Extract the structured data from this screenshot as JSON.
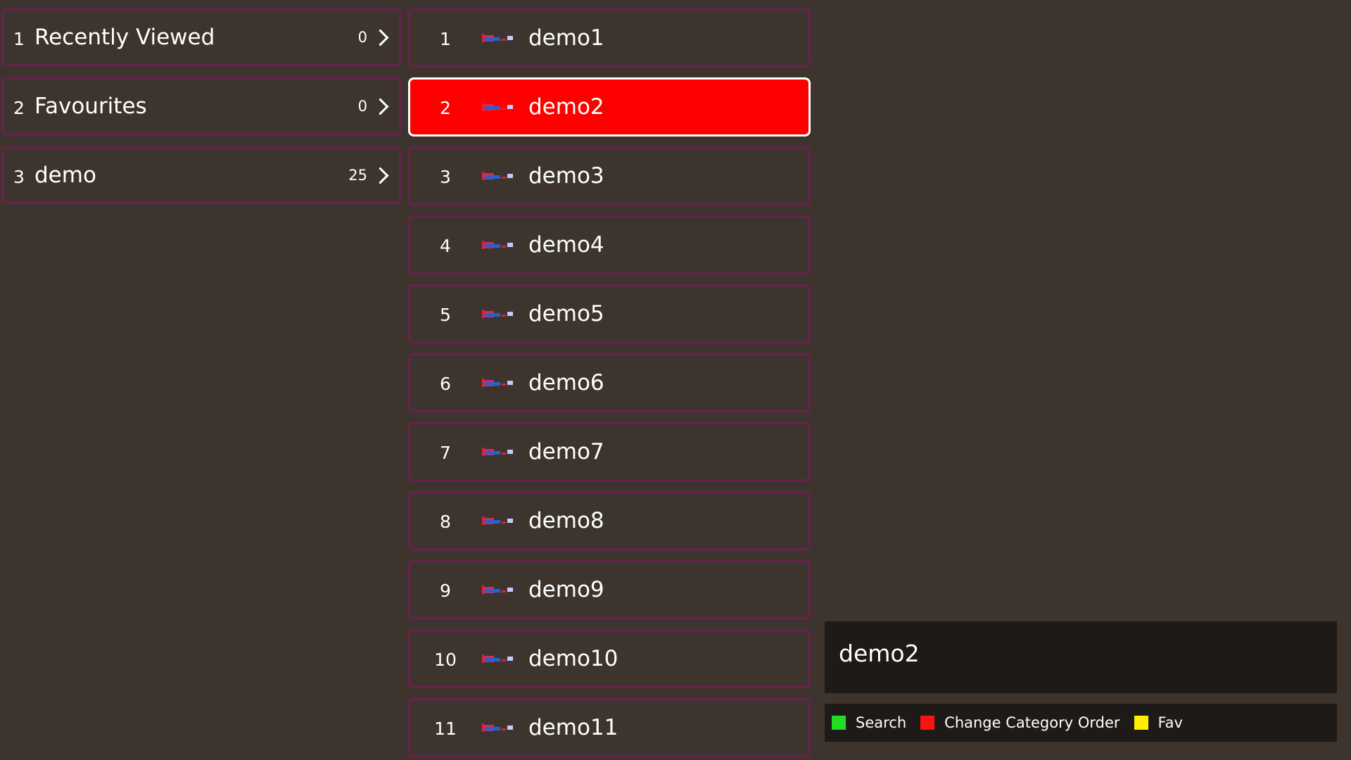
{
  "categories": [
    {
      "number": "1",
      "label": "Recently Viewed",
      "count": "0"
    },
    {
      "number": "2",
      "label": "Favourites",
      "count": "0"
    },
    {
      "number": "3",
      "label": "demo",
      "count": "25"
    }
  ],
  "channels": [
    {
      "number": "1",
      "label": "demo1",
      "logo": "channel-logo"
    },
    {
      "number": "2",
      "label": "demo2",
      "logo": "channel-logo",
      "selected": true
    },
    {
      "number": "3",
      "label": "demo3",
      "logo": "channel-logo"
    },
    {
      "number": "4",
      "label": "demo4",
      "logo": "channel-logo"
    },
    {
      "number": "5",
      "label": "demo5",
      "logo": "channel-logo"
    },
    {
      "number": "6",
      "label": "demo6",
      "logo": "channel-logo"
    },
    {
      "number": "7",
      "label": "demo7",
      "logo": "channel-logo"
    },
    {
      "number": "8",
      "label": "demo8",
      "logo": "channel-logo"
    },
    {
      "number": "9",
      "label": "demo9",
      "logo": "channel-logo"
    },
    {
      "number": "10",
      "label": "demo10",
      "logo": "channel-logo"
    },
    {
      "number": "11",
      "label": "demo11",
      "logo": "channel-logo"
    }
  ],
  "info": {
    "title": "demo2"
  },
  "legend": [
    {
      "color": "#22dd22",
      "label": "Search"
    },
    {
      "color": "#ff1111",
      "label": "Change Category Order"
    },
    {
      "color": "#ffee00",
      "label": "Fav"
    }
  ],
  "colors": {
    "background": "#3d352d",
    "item_border": "#6b1f4e",
    "selected_bg": "#ff0000",
    "panel_bg": "#1e1a17"
  }
}
